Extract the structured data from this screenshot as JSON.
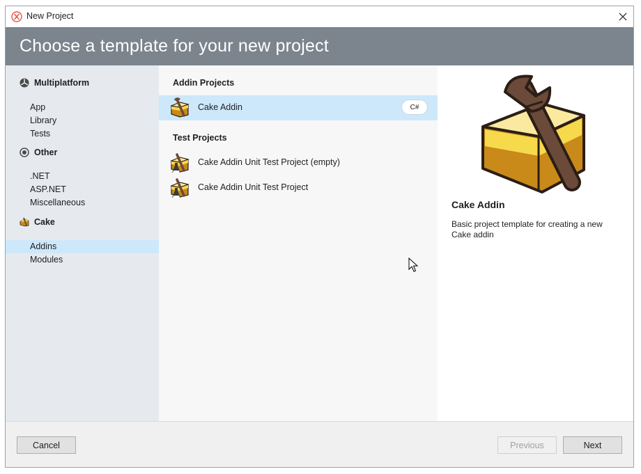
{
  "window": {
    "title": "New Project",
    "close_icon": "close-icon",
    "app_icon": "xamarin-logo-icon"
  },
  "header": {
    "title": "Choose a template for your new project"
  },
  "sidebar": {
    "categories": [
      {
        "label": "Multiplatform",
        "icon": "multiplatform-icon",
        "items": [
          "App",
          "Library",
          "Tests"
        ]
      },
      {
        "label": "Other",
        "icon": "other-icon",
        "items": [
          ".NET",
          "ASP.NET",
          "Miscellaneous"
        ]
      },
      {
        "label": "Cake",
        "icon": "cake-icon",
        "items": [
          "Addins",
          "Modules"
        ]
      }
    ],
    "selected": "Addins"
  },
  "templates": {
    "sections": [
      {
        "header": "Addin Projects",
        "items": [
          {
            "label": "Cake Addin",
            "language": "C#",
            "selected": true
          }
        ]
      },
      {
        "header": "Test Projects",
        "items": [
          {
            "label": "Cake Addin Unit Test Project (empty)"
          },
          {
            "label": "Cake Addin Unit Test Project"
          }
        ]
      }
    ]
  },
  "details": {
    "title": "Cake Addin",
    "description": "Basic project template for creating a new Cake addin"
  },
  "footer": {
    "cancel": "Cancel",
    "previous": "Previous",
    "next": "Next"
  },
  "colors": {
    "header_band": "#7c858e",
    "sidebar_bg": "#e6eaef",
    "selection": "#cde8fb",
    "cake_sponge": "#c98a1a",
    "cake_frosting": "#f7d94c",
    "wrench": "#6b4a3a"
  }
}
